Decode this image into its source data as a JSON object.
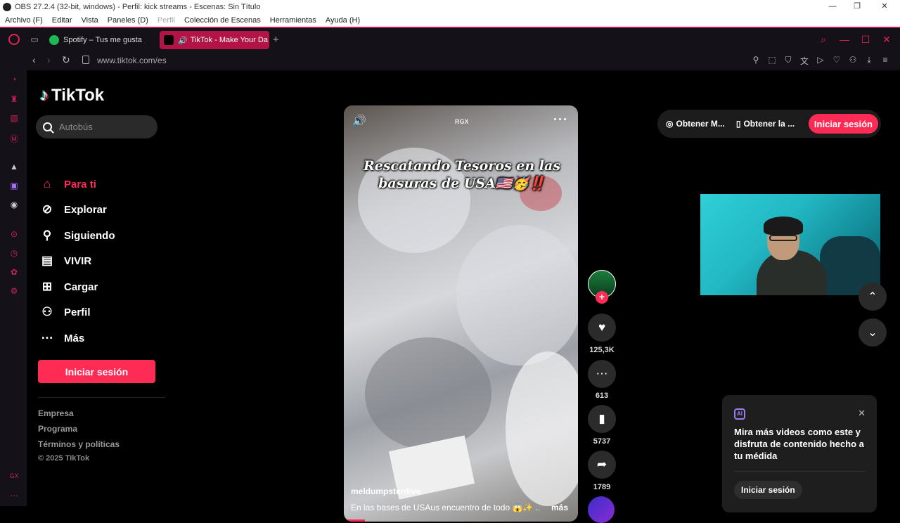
{
  "obs": {
    "title": "OBS 27.2.4 (32-bit, windows) - Perfil: kick streams - Escenas: Sin Título",
    "menu": [
      "Archivo (F)",
      "Editar",
      "Vista",
      "Paneles (D)",
      "Perfil",
      "Colección de Escenas",
      "Herramientas",
      "Ayuda (H)"
    ],
    "window_controls": [
      "—",
      "❐",
      "✕"
    ]
  },
  "browser": {
    "tabs": [
      {
        "label": "Spotify – Tus me gusta",
        "icon": "spotify-icon"
      },
      {
        "label": "TikTok - Make Your Da",
        "icon": "tiktok-icon"
      }
    ],
    "url": "www.tiktok.com/es"
  },
  "tiktok": {
    "logo_text": "TikTok",
    "search_placeholder": "Autobús",
    "nav": [
      {
        "label": "Para ti",
        "icon": "home-icon"
      },
      {
        "label": "Explorar",
        "icon": "compass-icon"
      },
      {
        "label": "Siguiendo",
        "icon": "following-icon"
      },
      {
        "label": "VIVIR",
        "icon": "live-icon"
      },
      {
        "label": "Cargar",
        "icon": "upload-icon"
      },
      {
        "label": "Perfil",
        "icon": "profile-icon"
      },
      {
        "label": "Más",
        "icon": "more-icon"
      }
    ],
    "login_label": "Iniciar sesión",
    "footer": [
      "Empresa",
      "Programa",
      "Términos y políticas"
    ],
    "copyright": "© 2025 TikTok",
    "top_bar": {
      "item1": "Obtener M...",
      "item2": "Obtener la ...",
      "login": "Iniciar sesión"
    }
  },
  "video": {
    "watermark": "RGX",
    "caption": "Rescatando Tesoros en las basuras de USA🇺🇸🥳‼️",
    "author": "meldumpsterdive",
    "description": "En las bases de USAus encuentro de todo 😱✨ ...",
    "more_label": "más",
    "likes": "125,3K",
    "comments": "613",
    "saves": "5737",
    "shares": "1789"
  },
  "ai_popup": {
    "text": "Mira más videos como este y disfruta de contenido hecho a tu médida",
    "login": "Iniciar sesión"
  }
}
